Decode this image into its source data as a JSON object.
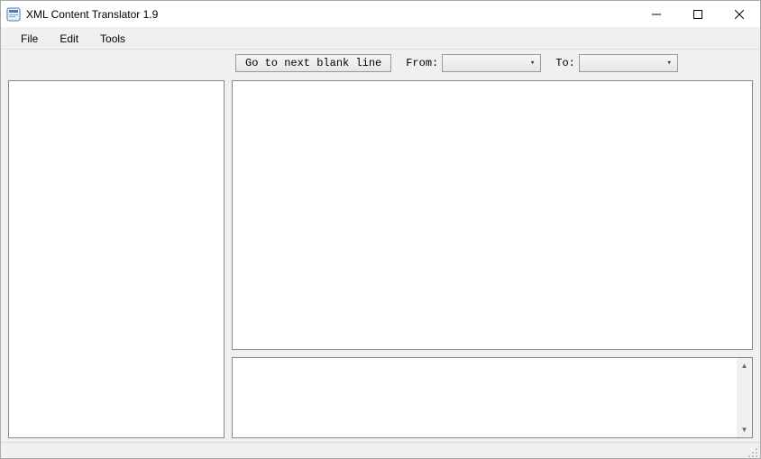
{
  "window": {
    "title": "XML Content Translator 1.9"
  },
  "menu": {
    "file": "File",
    "edit": "Edit",
    "tools": "Tools"
  },
  "toolbar": {
    "go_next_blank": "Go to next blank line",
    "from_label": "From:",
    "to_label": "To:",
    "from_value": "",
    "to_value": ""
  }
}
